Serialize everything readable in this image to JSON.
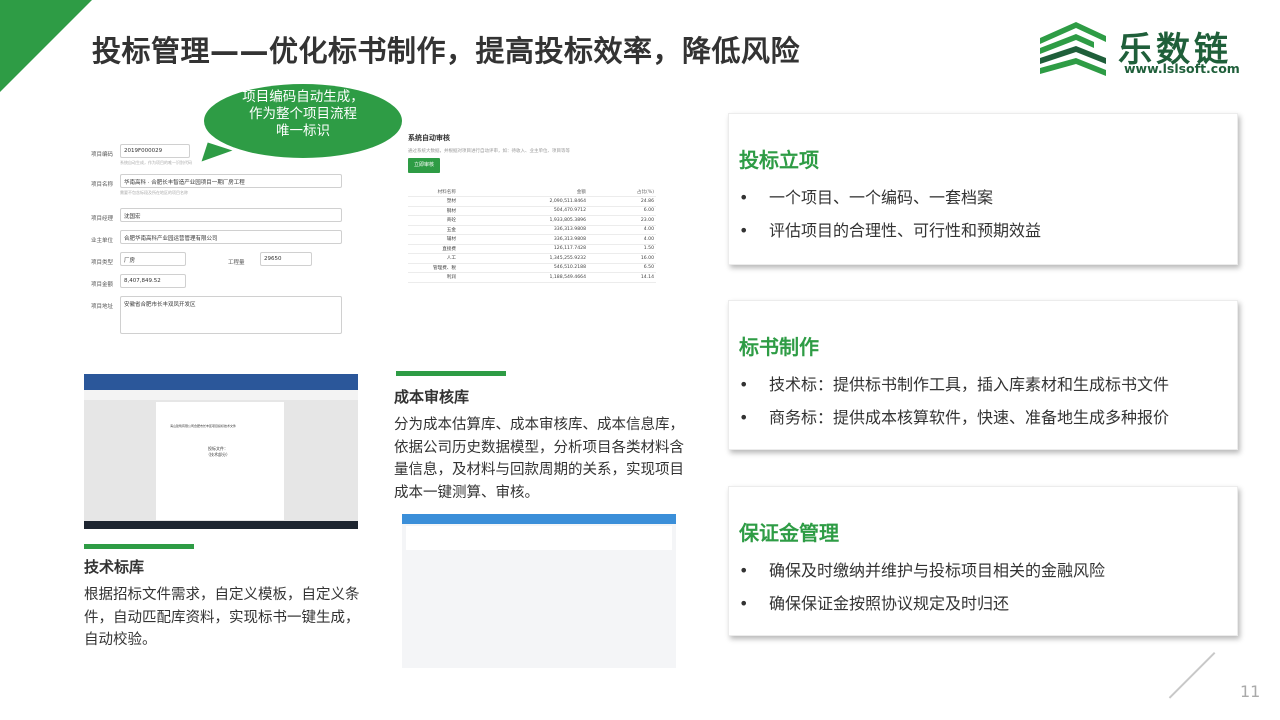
{
  "title": "投标管理——优化标书制作，提高投标效率，降低风险",
  "logo": {
    "name": "乐数链",
    "url": "www.lslsoft.com"
  },
  "colors": {
    "accent": "#2e9c45",
    "text": "#333333",
    "logo": "#1f5f3a"
  },
  "bubble": {
    "lines": [
      "项目编码自动生成，",
      "作为整个项目流程",
      "唯一标识"
    ]
  },
  "form": {
    "rows": [
      {
        "label": "项目编码",
        "value": "2019F000029",
        "hint": "系统自动生成，作为项目的唯一识别代码"
      },
      {
        "label": "项目名称",
        "value": "华南高科 · 合肥长丰智造产业园项目一期厂房工程",
        "hint": "需要不包含标段及所在地区的项目名称"
      },
      {
        "label": "项目经理",
        "value": "沈国宏",
        "hint": ""
      },
      {
        "label": "业主单位",
        "value": "合肥华南高科产业园运营管理有限公司",
        "hint": ""
      },
      {
        "label": "项目类型",
        "value": "厂房",
        "hint": ""
      },
      {
        "label": "项目金额",
        "value": "8,407,849.52",
        "hint": ""
      },
      {
        "label": "项目地址",
        "value": "安徽省合肥市长丰双凤开发区",
        "hint": ""
      }
    ],
    "quantity_label": "工程量",
    "quantity_value": "29650"
  },
  "review": {
    "title": "系统自动审核",
    "desc": "通过系统大数据，并根据对项目进行自动评审，如：待收入、业主单位、项目等等",
    "button": "立即审核",
    "columns": [
      "材料名称",
      "金额",
      "占比(%)"
    ],
    "rows": [
      [
        "塑材",
        "2,090,511.8464",
        "24.86"
      ],
      [
        "钢材",
        "504,470.9712",
        "6.00"
      ],
      [
        "商砼",
        "1,933,805.3896",
        "23.00"
      ],
      [
        "五金",
        "336,313.9808",
        "4.00"
      ],
      [
        "辅材",
        "336,313.9808",
        "4.00"
      ],
      [
        "直接费",
        "126,117.7428",
        "1.50"
      ],
      [
        "人工",
        "1,345,255.9232",
        "16.00"
      ],
      [
        "管理费、税",
        "546,510.2188",
        "6.50"
      ],
      [
        "利润",
        "1,188,549.4664",
        "14.14"
      ]
    ]
  },
  "doc": {
    "heading": "海山建筑有限公司合肥市长丰区项目投标技术文件",
    "sub_lines": [
      "投标文件：",
      "（技术部分）"
    ]
  },
  "tech_lib": {
    "heading": "技术标库",
    "text": "根据招标文件需求，自定义模板，自定义条件，自动匹配库资料，实现标书一键生成，自动校验。"
  },
  "cost_lib": {
    "heading": "成本审核库",
    "text": "分为成本估算库、成本审核库、成本信息库，依据公司历史数据模型，分析项目各类材料含量信息，及材料与回款周期的关系，实现项目成本一键测算、审核。"
  },
  "cards": [
    {
      "title": "投标立项",
      "items": [
        "一个项目、一个编码、一套档案",
        "评估项目的合理性、可行性和预期效益"
      ]
    },
    {
      "title": "标书制作",
      "items": [
        "技术标：提供标书制作工具，插入库素材和生成标书文件",
        "商务标：提供成本核算软件，快速、准备地生成多种报价"
      ]
    },
    {
      "title": "保证金管理",
      "items": [
        "确保及时缴纳并维护与投标项目相关的金融风险",
        "确保保证金按照协议规定及时归还"
      ]
    }
  ],
  "bullet_glyph": "•",
  "page_number": "11"
}
